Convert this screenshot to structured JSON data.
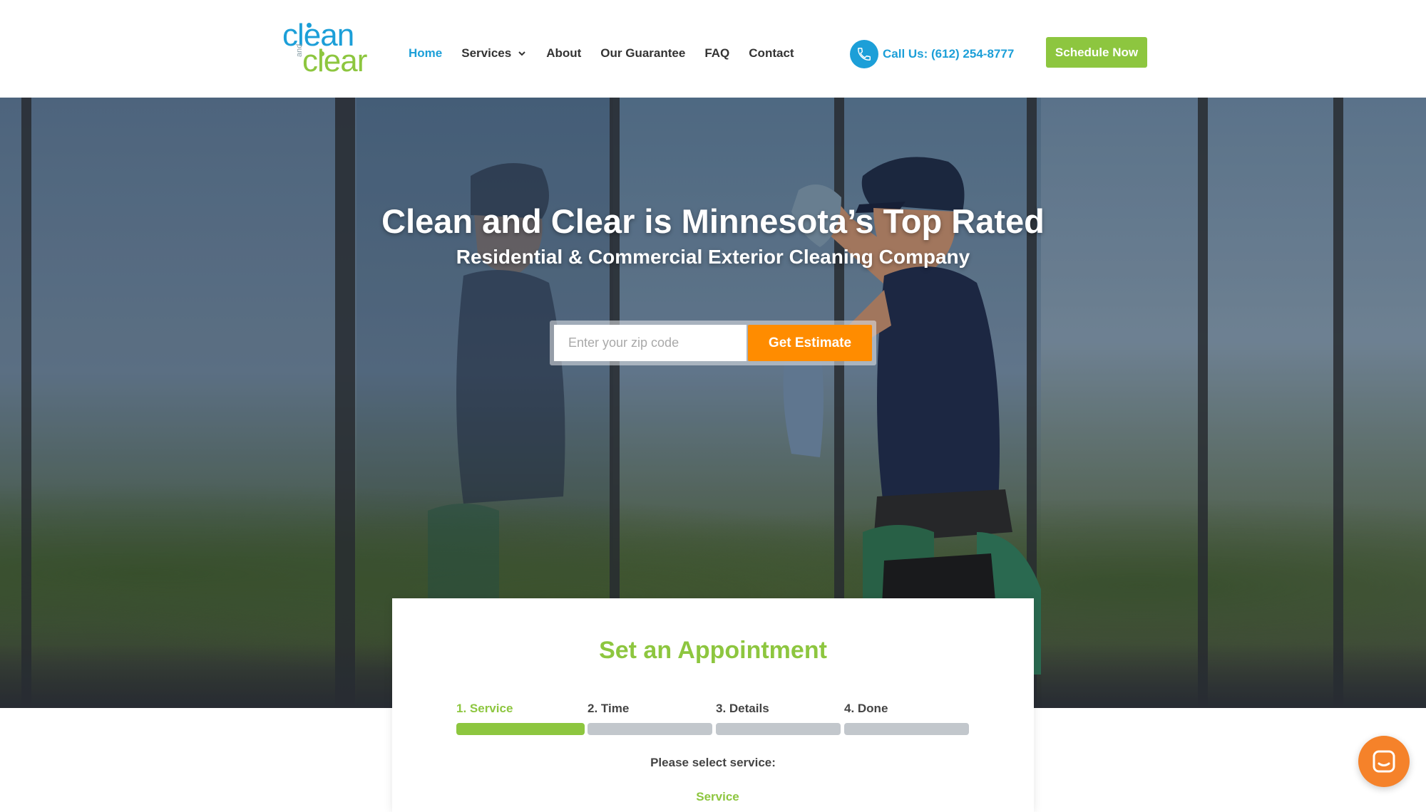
{
  "logo": {
    "word1": "clean",
    "word2": "and",
    "word3": "clear"
  },
  "nav": {
    "items": [
      {
        "label": "Home",
        "active": true
      },
      {
        "label": "Services",
        "dropdown": true
      },
      {
        "label": "About"
      },
      {
        "label": "Our Guarantee"
      },
      {
        "label": "FAQ"
      },
      {
        "label": "Contact"
      }
    ]
  },
  "call": {
    "label": "Call Us: (612) 254-8777",
    "icon": "phone-icon"
  },
  "schedule": {
    "label": "Schedule Now"
  },
  "hero": {
    "title": "Clean and Clear is Minnesota’s Top Rated",
    "subtitle": "Residential & Commercial Exterior Cleaning Company",
    "zip_placeholder": "Enter your zip code",
    "zip_value": "",
    "estimate_label": "Get Estimate"
  },
  "appointment": {
    "title": "Set an Appointment",
    "steps": [
      {
        "label": "1. Service",
        "active": true
      },
      {
        "label": "2. Time",
        "active": false
      },
      {
        "label": "3. Details",
        "active": false
      },
      {
        "label": "4. Done",
        "active": false
      }
    ],
    "prompt": "Please select service:",
    "service_label": "Service"
  },
  "chat": {
    "icon": "chat-icon"
  },
  "colors": {
    "blue": "#1c9fd8",
    "green": "#8dc63f",
    "orange": "#ff8c00",
    "chat_orange": "#f5822a",
    "step_inactive": "#c2c7cc"
  }
}
